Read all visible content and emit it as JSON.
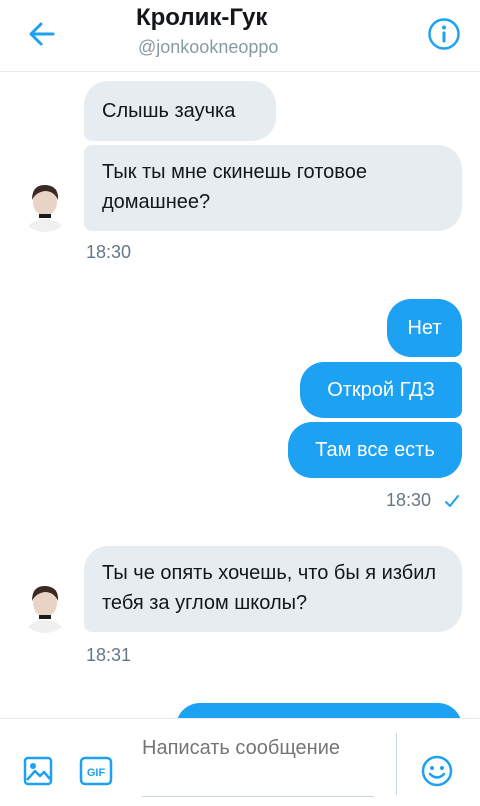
{
  "header": {
    "title": "Кролик-Гук",
    "handle": "@jonkookneoppo"
  },
  "messages": {
    "m1": "Слышь заучка",
    "m2": "Тык ты мне скинешь готовое домашнее?",
    "t1": "18:30",
    "m3": "Нет",
    "m4": "Открой ГДЗ",
    "m5": "Там все есть",
    "t2": "18:30",
    "m6": "Ты че опять хочешь, что бы я избил тебя за углом школы?",
    "t3": "18:31"
  },
  "composer": {
    "placeholder": "Написать сообщение"
  },
  "colors": {
    "accent": "#1da1f2",
    "incoming_bubble": "#e6ecf0"
  }
}
